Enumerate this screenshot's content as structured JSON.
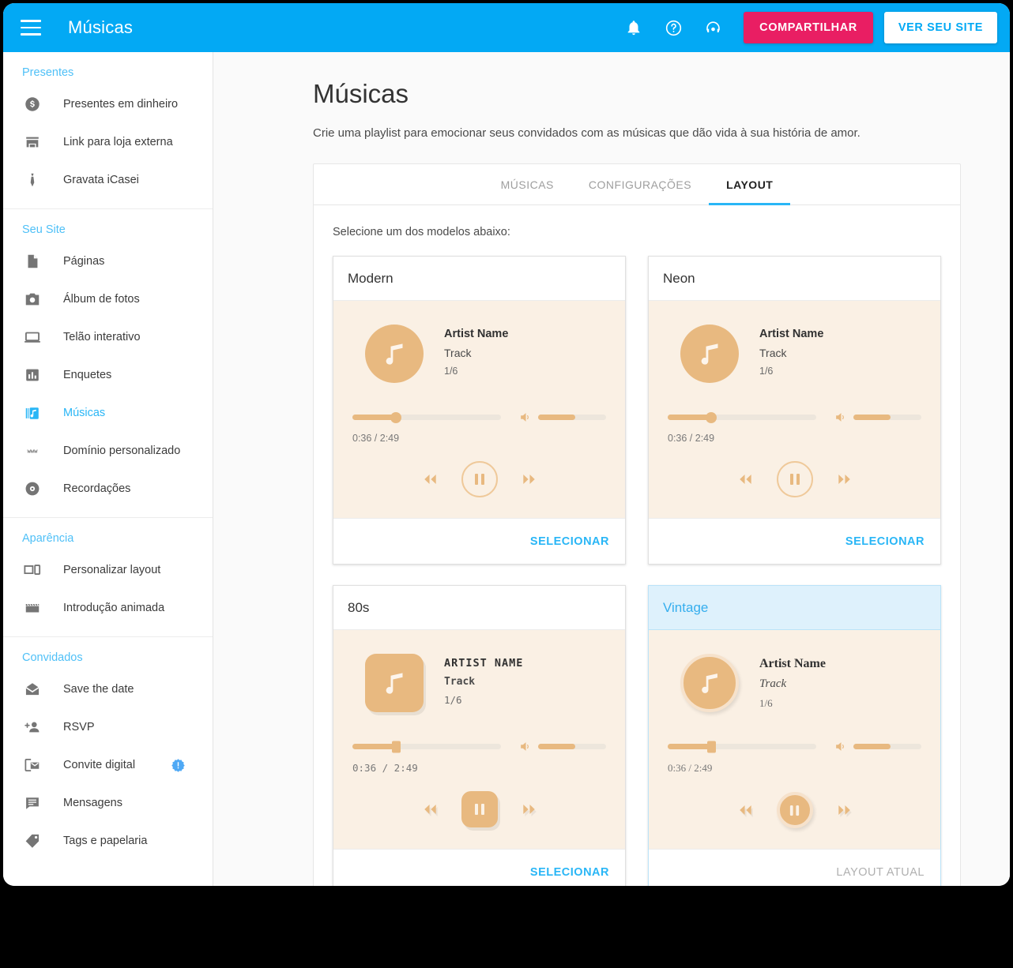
{
  "header": {
    "title": "Músicas",
    "menu_icon": "hamburger-icon",
    "notification_icon": "bell-icon",
    "help_icon": "question-circle-icon",
    "support_icon": "headset-icon",
    "share_label": "COMPARTILHAR",
    "view_site_label": "VER SEU SITE",
    "bg_color": "#03A9F4",
    "share_color": "#E91E63"
  },
  "sidebar": {
    "groups": [
      {
        "title": "Presentes",
        "items": [
          {
            "label": "Presentes em dinheiro",
            "icon": "money-circle-icon",
            "active": false
          },
          {
            "label": "Link para loja externa",
            "icon": "store-icon",
            "active": false
          },
          {
            "label": "Gravata iCasei",
            "icon": "tie-icon",
            "active": false
          }
        ]
      },
      {
        "title": "Seu Site",
        "items": [
          {
            "label": "Páginas",
            "icon": "page-icon",
            "active": false
          },
          {
            "label": "Álbum de fotos",
            "icon": "camera-icon",
            "active": false
          },
          {
            "label": "Telão interativo",
            "icon": "screen-icon",
            "active": false
          },
          {
            "label": "Enquetes",
            "icon": "bar-chart-icon",
            "active": false
          },
          {
            "label": "Músicas",
            "icon": "music-library-icon",
            "active": true
          },
          {
            "label": "Domínio personalizado",
            "icon": "www-icon",
            "active": false
          },
          {
            "label": "Recordações",
            "icon": "disc-icon",
            "active": false
          }
        ]
      },
      {
        "title": "Aparência",
        "items": [
          {
            "label": "Personalizar layout",
            "icon": "devices-icon",
            "active": false
          },
          {
            "label": "Introdução animada",
            "icon": "clapperboard-icon",
            "active": false
          }
        ]
      },
      {
        "title": "Convidados",
        "items": [
          {
            "label": "Save the date",
            "icon": "envelope-icon",
            "active": false
          },
          {
            "label": "RSVP",
            "icon": "add-person-icon",
            "active": false
          },
          {
            "label": "Convite digital",
            "icon": "mobile-invite-icon",
            "active": false,
            "badge": "alert-badge-icon"
          },
          {
            "label": "Mensagens",
            "icon": "message-icon",
            "active": false
          },
          {
            "label": "Tags e papelaria",
            "icon": "tag-icon",
            "active": false
          }
        ]
      }
    ],
    "active_color": "#29B6F6",
    "group_title_color": "#4FC0F7"
  },
  "main": {
    "page_title": "Músicas",
    "page_subtitle": "Crie uma playlist para emocionar seus convidados com as músicas que dão vida à sua história de amor.",
    "tabs": [
      {
        "label": "MÚSICAS",
        "active": false
      },
      {
        "label": "CONFIGURAÇÕES",
        "active": false
      },
      {
        "label": "LAYOUT",
        "active": true
      }
    ],
    "select_hint": "Selecione um dos modelos abaixo:",
    "select_label": "SELECIONAR",
    "current_layout_label": "LAYOUT ATUAL",
    "player_accent": "#E8B980",
    "player_bg": "#FAF0E4",
    "cards": [
      {
        "name": "Modern",
        "selected": false,
        "action": "SELECIONAR",
        "artist": "Artist Name",
        "track": "Track",
        "count": "1/6",
        "time": "0:36 / 2:49",
        "progress_percent": 29,
        "volume_percent": 55
      },
      {
        "name": "Neon",
        "selected": false,
        "action": "SELECIONAR",
        "artist": "Artist Name",
        "track": "Track",
        "count": "1/6",
        "time": "0:36 / 2:49",
        "progress_percent": 29,
        "volume_percent": 55
      },
      {
        "name": "80s",
        "selected": false,
        "action": "SELECIONAR",
        "artist": "ARTIST NAME",
        "track": "Track",
        "count": "1/6",
        "time": "0:36 / 2:49",
        "progress_percent": 29,
        "volume_percent": 55
      },
      {
        "name": "Vintage",
        "selected": true,
        "action": "LAYOUT ATUAL",
        "artist": "Artist Name",
        "track": "Track",
        "count": "1/6",
        "time": "0:36 / 2:49",
        "progress_percent": 29,
        "volume_percent": 55
      }
    ]
  }
}
